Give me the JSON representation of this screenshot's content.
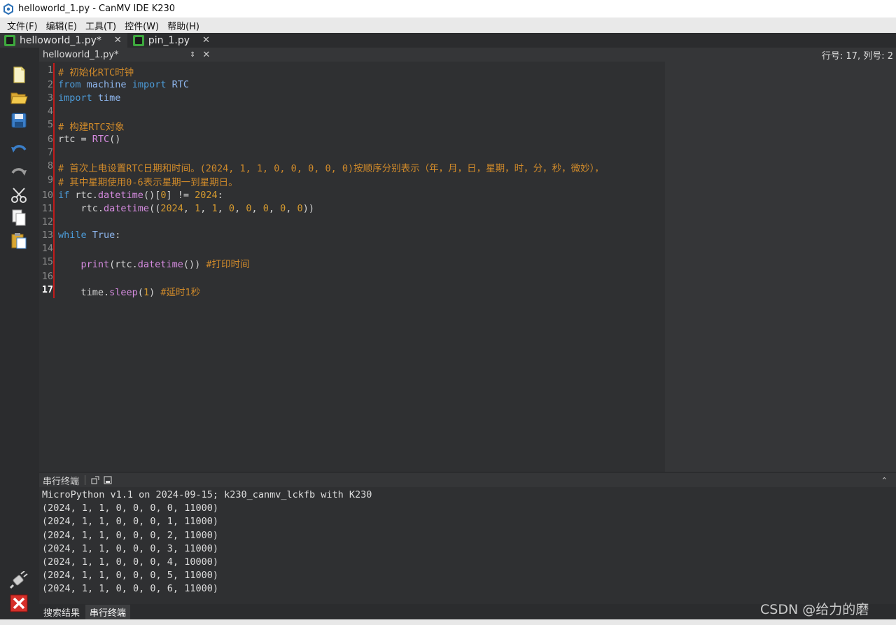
{
  "window": {
    "title": "helloworld_1.py - CanMV IDE K230"
  },
  "menu": [
    "文件(F)",
    "编辑(E)",
    "工具(T)",
    "控件(W)",
    "帮助(H)"
  ],
  "tabs": [
    {
      "label": "helloworld_1.py*",
      "close": "✕"
    },
    {
      "label": "pin_1.py",
      "close": "✕"
    }
  ],
  "editor_header": {
    "filename": "helloworld_1.py*",
    "arrows": "⇕",
    "close": "✕",
    "position": "行号: 17, 列号: 2"
  },
  "line_numbers": [
    "1",
    "2",
    "3",
    "4",
    "5",
    "6",
    "7",
    "8",
    "9",
    "10",
    "11",
    "12",
    "13",
    "14",
    "15",
    "16",
    "17"
  ],
  "code_lines": [
    [
      [
        "c-com",
        "# 初始化RTC时钟"
      ]
    ],
    [
      [
        "c-kw",
        "from"
      ],
      [
        "c-txt",
        " "
      ],
      [
        "c-mod",
        "machine"
      ],
      [
        "c-txt",
        " "
      ],
      [
        "c-kw",
        "import"
      ],
      [
        "c-txt",
        " "
      ],
      [
        "c-mod",
        "RTC"
      ]
    ],
    [
      [
        "c-kw",
        "import"
      ],
      [
        "c-txt",
        " "
      ],
      [
        "c-mod",
        "time"
      ]
    ],
    [],
    [
      [
        "c-com",
        "# 构建RTC对象"
      ]
    ],
    [
      [
        "c-txt",
        "rtc = "
      ],
      [
        "c-fn",
        "RTC"
      ],
      [
        "c-txt",
        "()"
      ]
    ],
    [],
    [
      [
        "c-com",
        "# 首次上电设置RTC日期和时间。(2024, 1, 1, 0, 0, 0, 0, 0)按顺序分别表示（年，月，日，星期，时，分，秒，微妙），"
      ]
    ],
    [
      [
        "c-com",
        "# 其中星期使用0-6表示星期一到星期日。"
      ]
    ],
    [
      [
        "c-kw",
        "if"
      ],
      [
        "c-txt",
        " rtc."
      ],
      [
        "c-fn",
        "datetime"
      ],
      [
        "c-txt",
        "()["
      ],
      [
        "c-num",
        "0"
      ],
      [
        "c-txt",
        "] != "
      ],
      [
        "c-num",
        "2024"
      ],
      [
        "c-txt",
        ":"
      ]
    ],
    [
      [
        "c-txt",
        "    rtc."
      ],
      [
        "c-fn",
        "datetime"
      ],
      [
        "c-txt",
        "(("
      ],
      [
        "c-num",
        "2024"
      ],
      [
        "c-txt",
        ", "
      ],
      [
        "c-num",
        "1"
      ],
      [
        "c-txt",
        ", "
      ],
      [
        "c-num",
        "1"
      ],
      [
        "c-txt",
        ", "
      ],
      [
        "c-num",
        "0"
      ],
      [
        "c-txt",
        ", "
      ],
      [
        "c-num",
        "0"
      ],
      [
        "c-txt",
        ", "
      ],
      [
        "c-num",
        "0"
      ],
      [
        "c-txt",
        ", "
      ],
      [
        "c-num",
        "0"
      ],
      [
        "c-txt",
        ", "
      ],
      [
        "c-num",
        "0"
      ],
      [
        "c-txt",
        "))"
      ]
    ],
    [],
    [
      [
        "c-kw",
        "while"
      ],
      [
        "c-txt",
        " "
      ],
      [
        "c-mod",
        "True"
      ],
      [
        "c-txt",
        ":"
      ]
    ],
    [],
    [
      [
        "c-txt",
        "    "
      ],
      [
        "c-fn",
        "print"
      ],
      [
        "c-txt",
        "(rtc."
      ],
      [
        "c-fn",
        "datetime"
      ],
      [
        "c-txt",
        "()) "
      ],
      [
        "c-com",
        "#打印时间"
      ]
    ],
    [],
    [
      [
        "c-txt",
        "    time."
      ],
      [
        "c-fn",
        "sleep"
      ],
      [
        "c-txt",
        "("
      ],
      [
        "c-num",
        "1"
      ],
      [
        "c-txt",
        ") "
      ],
      [
        "c-com",
        "#延时1秒"
      ]
    ]
  ],
  "terminal": {
    "title": "串行终端",
    "collapse": "⌃",
    "lines": [
      "MicroPython v1.1 on 2024-09-15; k230_canmv_lckfb with K230",
      "(2024, 1, 1, 0, 0, 0, 0, 11000)",
      "(2024, 1, 1, 0, 0, 0, 1, 11000)",
      "(2024, 1, 1, 0, 0, 0, 2, 11000)",
      "(2024, 1, 1, 0, 0, 0, 3, 11000)",
      "(2024, 1, 1, 0, 0, 0, 4, 10000)",
      "(2024, 1, 1, 0, 0, 0, 5, 11000)",
      "(2024, 1, 1, 0, 0, 0, 6, 11000)"
    ]
  },
  "bottom_tabs": [
    "搜索结果",
    "串行终端"
  ],
  "watermark": "CSDN @给力的磨"
}
